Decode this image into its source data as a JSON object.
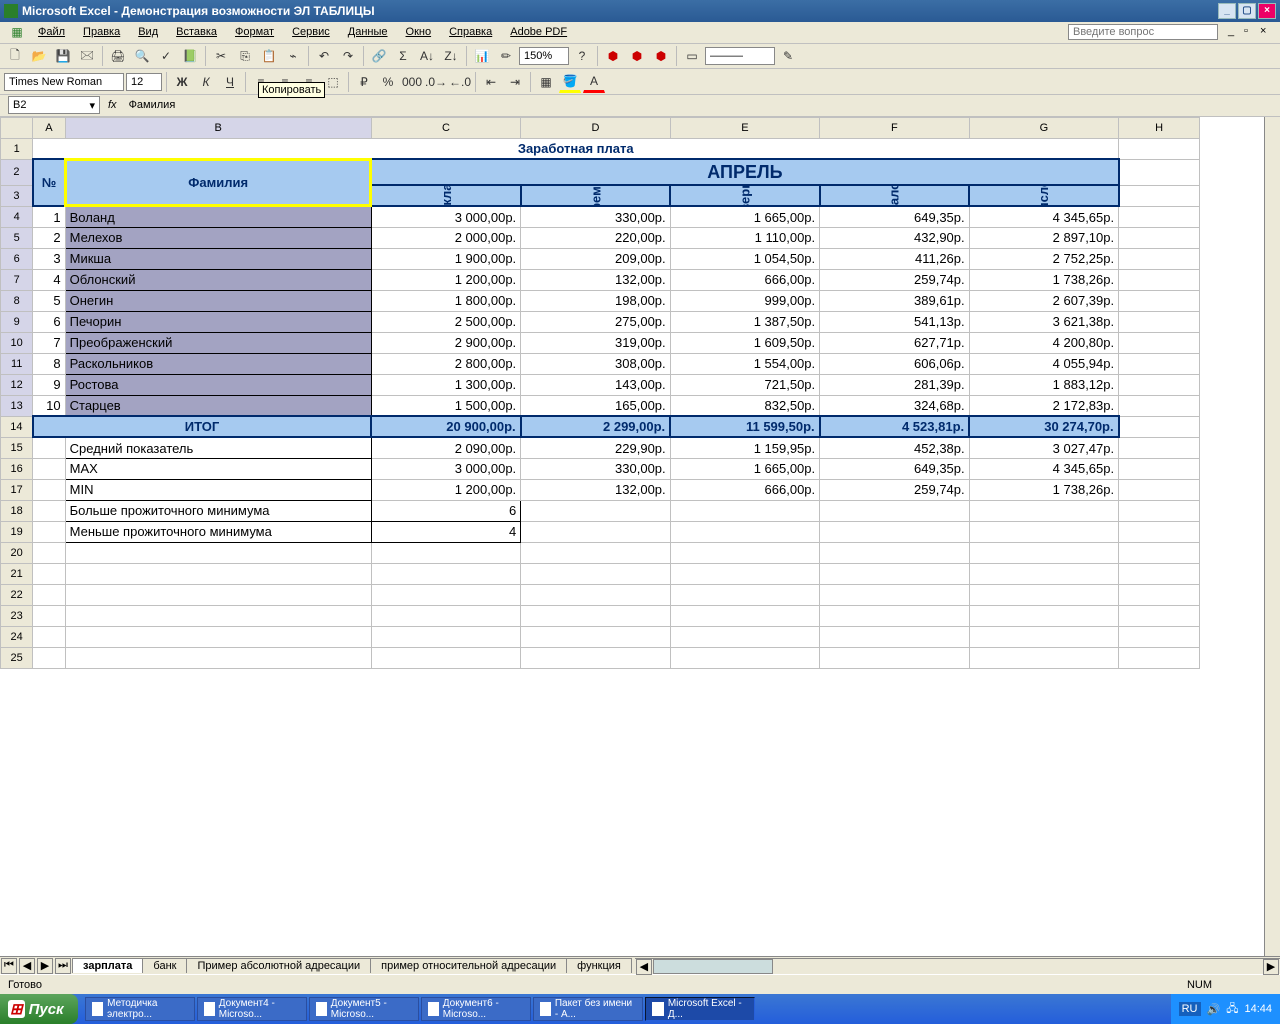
{
  "app": {
    "title": "Microsoft Excel - Демонстрация возможности ЭЛ ТАБЛИЦЫ"
  },
  "menu": [
    "Файл",
    "Правка",
    "Вид",
    "Вставка",
    "Формат",
    "Сервис",
    "Данные",
    "Окно",
    "Справка",
    "Adobe PDF"
  ],
  "question_placeholder": "Введите вопрос",
  "tooltip": "Копировать",
  "font": {
    "name": "Times New Roman",
    "size": "12"
  },
  "zoom": "150%",
  "cellref": "B2",
  "formula": "Фамилия",
  "cols": [
    "A",
    "B",
    "C",
    "D",
    "E",
    "F",
    "G",
    "H"
  ],
  "title": "Заработная плата",
  "month": "АПРЕЛЬ",
  "hdr_num": "№",
  "hdr_fam": "Фамилия",
  "hdr_cols": [
    "Оклад",
    "Премия",
    "Северные",
    "Налог",
    "Начисление"
  ],
  "rows": [
    {
      "n": "1",
      "fam": "Воланд",
      "v": [
        "3 000,00р.",
        "330,00р.",
        "1 665,00р.",
        "649,35р.",
        "4 345,65р."
      ]
    },
    {
      "n": "2",
      "fam": "Мелехов",
      "v": [
        "2 000,00р.",
        "220,00р.",
        "1 110,00р.",
        "432,90р.",
        "2 897,10р."
      ]
    },
    {
      "n": "3",
      "fam": "Микша",
      "v": [
        "1 900,00р.",
        "209,00р.",
        "1 054,50р.",
        "411,26р.",
        "2 752,25р."
      ]
    },
    {
      "n": "4",
      "fam": "Облонский",
      "v": [
        "1 200,00р.",
        "132,00р.",
        "666,00р.",
        "259,74р.",
        "1 738,26р."
      ]
    },
    {
      "n": "5",
      "fam": "Онегин",
      "v": [
        "1 800,00р.",
        "198,00р.",
        "999,00р.",
        "389,61р.",
        "2 607,39р."
      ]
    },
    {
      "n": "6",
      "fam": "Печорин",
      "v": [
        "2 500,00р.",
        "275,00р.",
        "1 387,50р.",
        "541,13р.",
        "3 621,38р."
      ]
    },
    {
      "n": "7",
      "fam": "Преображенский",
      "v": [
        "2 900,00р.",
        "319,00р.",
        "1 609,50р.",
        "627,71р.",
        "4 200,80р."
      ]
    },
    {
      "n": "8",
      "fam": "Раскольников",
      "v": [
        "2 800,00р.",
        "308,00р.",
        "1 554,00р.",
        "606,06р.",
        "4 055,94р."
      ]
    },
    {
      "n": "9",
      "fam": "Ростова",
      "v": [
        "1 300,00р.",
        "143,00р.",
        "721,50р.",
        "281,39р.",
        "1 883,12р."
      ]
    },
    {
      "n": "10",
      "fam": "Старцев",
      "v": [
        "1 500,00р.",
        "165,00р.",
        "832,50р.",
        "324,68р.",
        "2 172,83р."
      ]
    }
  ],
  "itog_label": "ИТОГ",
  "itog": [
    "20 900,00р.",
    "2 299,00р.",
    "11 599,50р.",
    "4 523,81р.",
    "30 274,70р."
  ],
  "stats": [
    {
      "label": "Средний показатель",
      "v": [
        "2 090,00р.",
        "229,90р.",
        "1 159,95р.",
        "452,38р.",
        "3 027,47р."
      ]
    },
    {
      "label": "MAX",
      "v": [
        "3 000,00р.",
        "330,00р.",
        "1 665,00р.",
        "649,35р.",
        "4 345,65р."
      ]
    },
    {
      "label": "MIN",
      "v": [
        "1 200,00р.",
        "132,00р.",
        "666,00р.",
        "259,74р.",
        "1 738,26р."
      ]
    }
  ],
  "extra": [
    {
      "label": "Больше прожиточного минимума",
      "v": "6"
    },
    {
      "label": "Меньше прожиточного минимума",
      "v": "4"
    }
  ],
  "sheet_tabs": [
    "зарплата",
    "банк",
    "Пример абсолютной адресации",
    "пример относительной адресации",
    "функция"
  ],
  "status": "Готово",
  "status_num": "NUM",
  "start": "Пуск",
  "taskbar": [
    "Методичка электро...",
    "Документ4 - Microso...",
    "Документ5 - Microso...",
    "Документ6 - Microso...",
    "Пакет без имени - A...",
    "Microsoft Excel - Д..."
  ],
  "lang": "RU",
  "clock": "14:44"
}
